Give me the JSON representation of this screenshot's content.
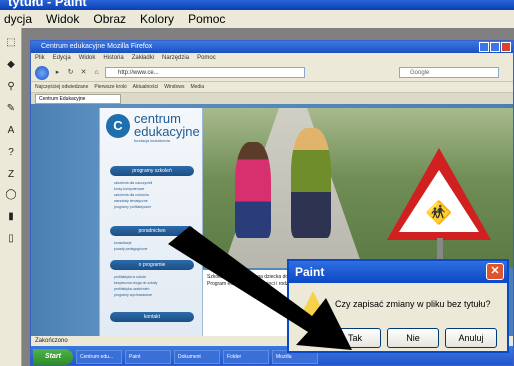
{
  "paint": {
    "title": "tytułu - Paint",
    "menu": [
      "dycja",
      "Widok",
      "Obraz",
      "Kolory",
      "Pomoc"
    ]
  },
  "browser": {
    "window_title": "Centrum edukacyjne Mozilla Firefox",
    "menu": [
      "Plik",
      "Edycja",
      "Widok",
      "Historia",
      "Zakładki",
      "Narzędzia",
      "Pomoc"
    ],
    "url": "http://www.ce...",
    "search_placeholder": "Google",
    "bookmarks": [
      "Najczęściej odwiedzane",
      "Pierwsze kroki",
      "Aktualności",
      "Windows",
      "Media"
    ],
    "tab": "Centrum Edukacyjne",
    "status": "Zakończono",
    "taskbar": {
      "start": "Start",
      "tasks": [
        "Centrum edu...",
        "Paint",
        "Dokument",
        "Folder",
        "Mozilla"
      ]
    }
  },
  "site": {
    "logo_glyph": "C",
    "logo_line1": "centrum",
    "logo_line2": "edukacyjne",
    "logo_sub": "fundacja kształcenia",
    "sections": [
      {
        "title": "programy szkoleń",
        "lines": [
          "szkolenia dla nauczycieli",
          "kursy komputerowe",
          "szkolenia dla rodziców",
          "warsztaty tematyczne",
          "programy profilaktyczne"
        ]
      },
      {
        "title": "poradnictwo",
        "lines": [
          "konsultacje",
          "porady pedagogiczne"
        ]
      },
      {
        "title": "o programie",
        "lines": [
          "profilaktyka w szkole",
          "bezpieczna droga do szkoły",
          "profilaktyka uzależnień",
          "programy wychowawcze"
        ]
      },
      {
        "title": "kontakt",
        "lines": []
      }
    ],
    "body_text": "Szkoła bezpieczna droga dziecka do szkoły. Program edukacyjny dla dzieci i rodziców."
  },
  "dialog": {
    "title": "Paint",
    "message": "Czy zapisać zmiany w pliku bez tytułu?",
    "buttons": [
      "Tak",
      "Nie",
      "Anuluj"
    ],
    "close_glyph": "✕"
  },
  "colors": {
    "xp_blue": "#0a49c8",
    "page_blue": "#4a7fb2",
    "sign_red": "#d12020"
  }
}
